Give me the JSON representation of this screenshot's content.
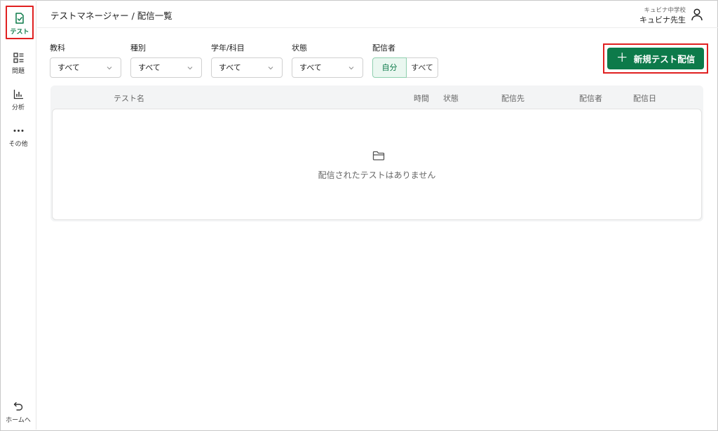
{
  "sidebar": {
    "items": [
      {
        "label": "テスト",
        "icon": "test-icon"
      },
      {
        "label": "問題",
        "icon": "questions-icon"
      },
      {
        "label": "分析",
        "icon": "chart-icon"
      },
      {
        "label": "その他",
        "icon": "more-icon"
      }
    ],
    "home_label": "ホームへ"
  },
  "header": {
    "breadcrumb": "テストマネージャー / 配信一覧",
    "school": "キュビナ中学校",
    "teacher": "キュビナ先生"
  },
  "filters": {
    "subject": {
      "label": "教科",
      "value": "すべて"
    },
    "type": {
      "label": "種別",
      "value": "すべて"
    },
    "grade": {
      "label": "学年/科目",
      "value": "すべて"
    },
    "status": {
      "label": "状態",
      "value": "すべて"
    },
    "distributor": {
      "label": "配信者",
      "options": [
        "自分",
        "すべて"
      ],
      "selected": "自分"
    }
  },
  "new_button_label": "新規テスト配信",
  "table": {
    "columns": [
      "テスト名",
      "時間",
      "状態",
      "配信先",
      "配信者",
      "配信日"
    ],
    "empty_message": "配信されたテストはありません"
  },
  "colors": {
    "accent": "#0d7a4a",
    "highlight": "#e02020"
  }
}
